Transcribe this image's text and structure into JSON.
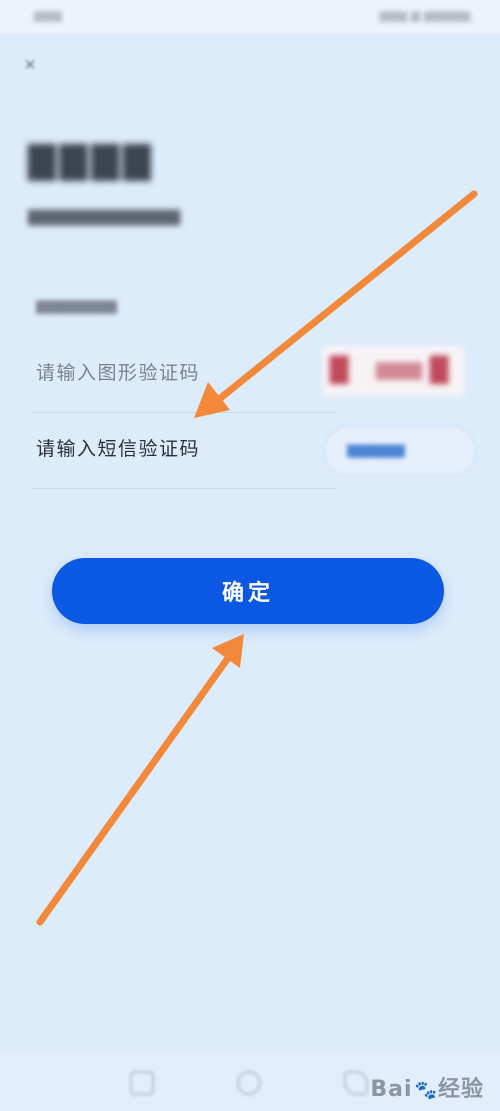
{
  "form": {
    "image_code_placeholder": "请输入图形验证码",
    "sms_code_placeholder": "请输入短信验证码",
    "confirm_label": "确定"
  },
  "watermark": {
    "text_left": "Bai",
    "text_right": "经验"
  },
  "colors": {
    "background": "#ddecfb",
    "primary_button": "#0a58e4",
    "annotation_arrow": "#f2893a"
  },
  "icons": {
    "close": "close-icon",
    "annotation": "arrow-icon"
  }
}
